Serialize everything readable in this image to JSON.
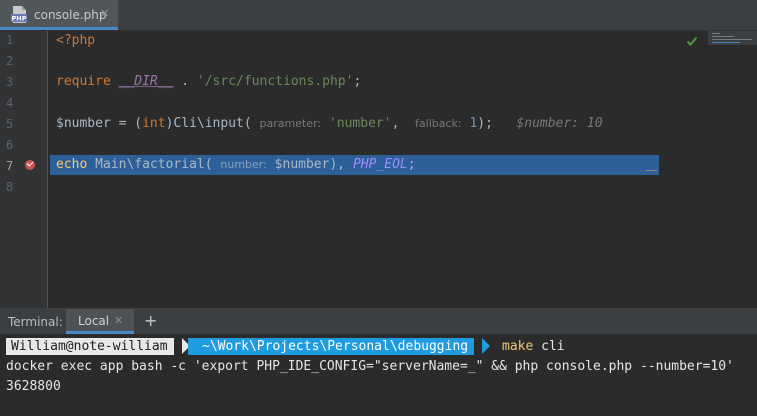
{
  "tab": {
    "file_name": "console.php",
    "icon": "php-file-icon",
    "icon_label": "PHP",
    "close": "✕"
  },
  "gutter": {
    "line_numbers": [
      "1",
      "2",
      "3",
      "4",
      "5",
      "6",
      "7",
      "8"
    ],
    "breakpoint_line": "7"
  },
  "code": {
    "line1": {
      "open_tag": "<?php"
    },
    "line3": {
      "keyword": "require",
      "magic": "__DIR__",
      "dot": " . ",
      "string": "'/src/functions.php'",
      "end": ";"
    },
    "line5": {
      "var": "$number",
      "assign": " = (",
      "cast": "int",
      "call": ")Cli\\input(",
      "hint1": "parameter:",
      "arg1": "'number'",
      "comma": ", ",
      "hint2": "fallback:",
      "arg2": "1",
      "close": ");",
      "inline_value": "$number: 10"
    },
    "line7": {
      "keyword": "echo",
      "ns": " Main\\",
      "fn": "factorial(",
      "hint": "number:",
      "arg": "$number",
      "comma": "), ",
      "const": "PHP_EOL",
      "end": ";"
    }
  },
  "terminal": {
    "title": "Terminal:",
    "tab_label": "Local",
    "tab_close": "✕",
    "add": "+",
    "prompt_user": "William@note-william",
    "prompt_path": "~\\Work\\Projects\\Personal\\debugging",
    "command_name": "make",
    "command_args": " cli",
    "output_line1": "docker exec app bash -c 'export PHP_IDE_CONFIG=\"serverName=_\" && php console.php --number=10'",
    "output_line2": "3628800"
  },
  "colors": {
    "editor_bg": "#2b2b2b",
    "exec_line": "#2d6099",
    "breakpoint": "#c75450",
    "prompt_path_bg": "#1e9cdf",
    "inspection_ok": "#4e9a3c"
  }
}
